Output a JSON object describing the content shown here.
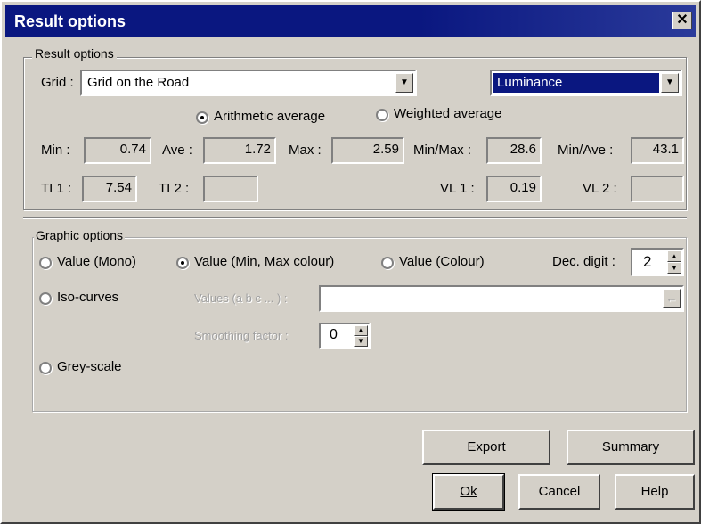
{
  "window": {
    "title": "Result options",
    "close_glyph": "✕"
  },
  "result_group": {
    "label": "Result options",
    "grid_label": "Grid :",
    "grid_value": "Grid on the Road",
    "quantity_value": "Luminance",
    "avg_options": [
      "Arithmetic average",
      "Weighted average"
    ],
    "stats": {
      "min_label": "Min :",
      "min_value": "0.74",
      "ave_label": "Ave :",
      "ave_value": "1.72",
      "max_label": "Max :",
      "max_value": "2.59",
      "minmax_label": "Min/Max :",
      "minmax_value": "28.6",
      "minave_label": "Min/Ave :",
      "minave_value": "43.1",
      "ti1_label": "TI 1 :",
      "ti1_value": "7.54",
      "ti2_label": "TI 2 :",
      "ti2_value": "",
      "vl1_label": "VL 1 :",
      "vl1_value": "0.19",
      "vl2_label": "VL 2 :",
      "vl2_value": ""
    }
  },
  "graphic_group": {
    "label": "Graphic options",
    "value_mono": "Value (Mono)",
    "value_minmax": "Value (Min, Max colour)",
    "value_colour": "Value (Colour)",
    "dec_digit_label": "Dec. digit :",
    "dec_digit_value": "2",
    "iso_curves": "Iso-curves",
    "values_label": "Values (a b c ... ) :",
    "values_value": "",
    "smoothing_label": "Smoothing factor :",
    "smoothing_value": "0",
    "grey_scale": "Grey-scale",
    "arrow_glyph": "←"
  },
  "buttons": {
    "export": "Export",
    "summary": "Summary",
    "ok": "Ok",
    "cancel": "Cancel",
    "help": "Help"
  },
  "colors": {
    "title_bar": "#0a1780",
    "selection": "#0a1780",
    "face": "#d4d0c8"
  }
}
